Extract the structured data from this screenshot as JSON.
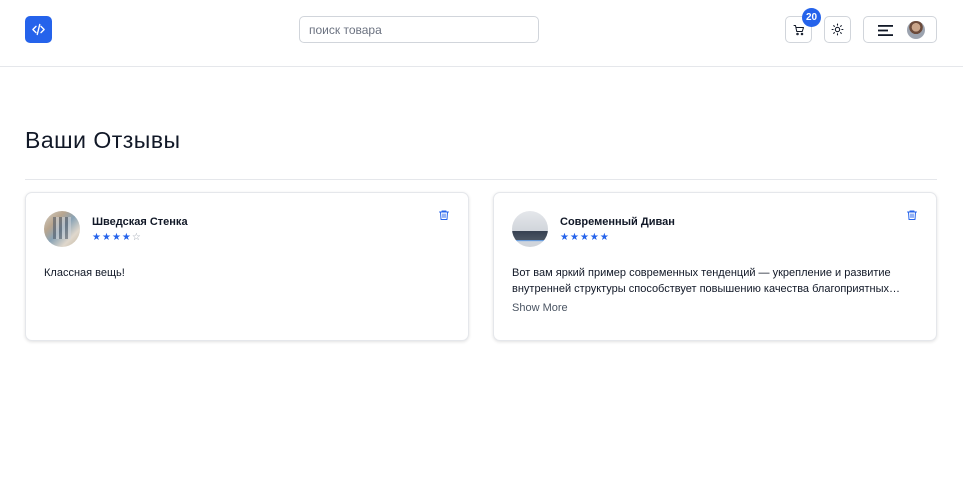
{
  "header": {
    "search_placeholder": "поиск товара",
    "search_value": "",
    "cart_count": "20",
    "logo_icon": "code-icon",
    "cart_icon": "cart-icon",
    "theme_icon": "sun-icon",
    "menu_icon": "menu-icon"
  },
  "page": {
    "title": "Ваши Отзывы"
  },
  "reviews": [
    {
      "product": "Шведская Стенка",
      "rating": 4,
      "max_rating": 5,
      "text": "Классная вещь!",
      "show_more": null
    },
    {
      "product": "Современный Диван",
      "rating": 5,
      "max_rating": 5,
      "text": "Вот вам яркий пример современных тенденций — укрепление и развитие внутренней структуры способствует повышению качества благоприятных условий",
      "show_more": "Show More"
    }
  ],
  "colors": {
    "accent": "#2563eb",
    "border": "#e5e7eb"
  }
}
